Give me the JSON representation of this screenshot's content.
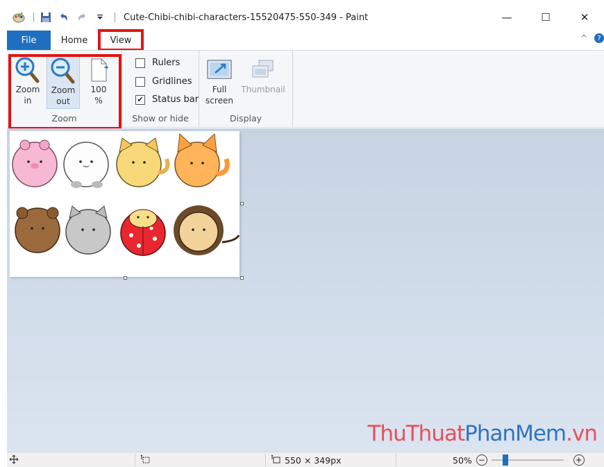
{
  "window": {
    "title": "Cute-Chibi-chibi-characters-15520475-550-349 - Paint",
    "minimize_glyph": "—",
    "maximize_glyph": "☐",
    "close_glyph": "✕"
  },
  "quick_access": {
    "icons": [
      "paint-app-icon",
      "save-icon",
      "undo-icon",
      "redo-icon",
      "customize-dropdown-icon"
    ]
  },
  "tabs": {
    "file": "File",
    "home": "Home",
    "view": "View",
    "collapse_glyph": "^",
    "help_glyph": "?"
  },
  "ribbon": {
    "zoom": {
      "label": "Zoom",
      "zoom_in_l1": "Zoom",
      "zoom_in_l2": "in",
      "zoom_out_l1": "Zoom",
      "zoom_out_l2": "out",
      "full_l1": "100",
      "full_l2": "%"
    },
    "show_hide": {
      "label": "Show or hide",
      "rulers": "Rulers",
      "gridlines": "Gridlines",
      "status_bar": "Status bar",
      "checked_glyph": "✔"
    },
    "display": {
      "label": "Display",
      "full_screen_l1": "Full",
      "full_screen_l2": "screen",
      "thumbnail": "Thumbnail"
    }
  },
  "status": {
    "image_size": "550 × 349px",
    "zoom_level": "50%",
    "zoom_fraction": 0.2,
    "minus_glyph": "−",
    "plus_glyph": "+"
  },
  "watermark": {
    "part1": "ThuThuat",
    "part2": "PhanMem",
    "part3": ".vn"
  },
  "colors": {
    "accent": "#1e6fbf",
    "highlight_frame": "#e01515"
  }
}
